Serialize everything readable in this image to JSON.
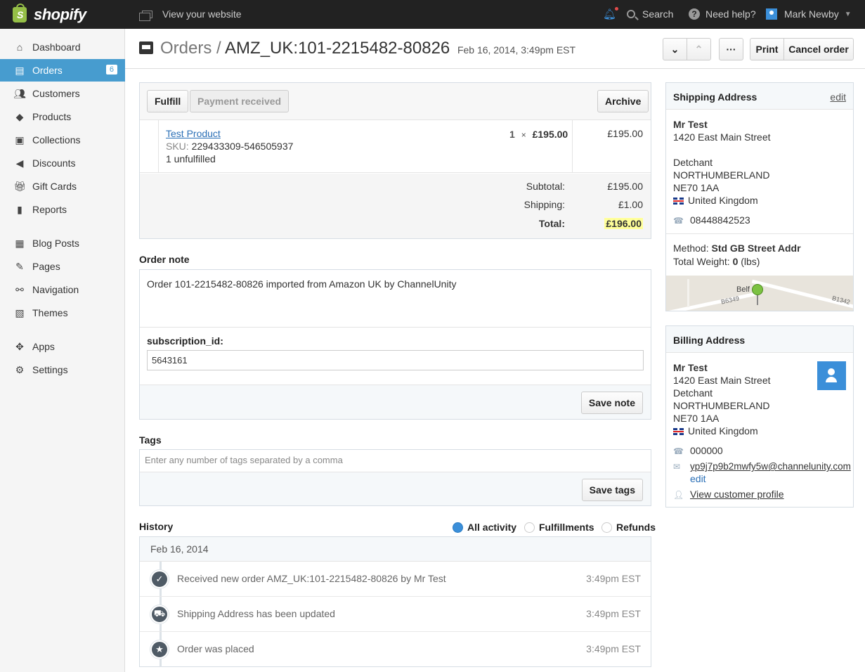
{
  "topbar": {
    "brand": "shopify",
    "view_website": "View your website",
    "search": "Search",
    "help": "Need help?",
    "user": "Mark Newby"
  },
  "sidebar": {
    "items": [
      {
        "label": "Dashboard",
        "icon": "home-icon"
      },
      {
        "label": "Orders",
        "icon": "orders-icon",
        "badge": "6",
        "active": true
      },
      {
        "label": "Customers",
        "icon": "customers-icon"
      },
      {
        "label": "Products",
        "icon": "tag-icon"
      },
      {
        "label": "Collections",
        "icon": "box-icon"
      },
      {
        "label": "Discounts",
        "icon": "megaphone-icon"
      },
      {
        "label": "Gift Cards",
        "icon": "gift-icon"
      },
      {
        "label": "Reports",
        "icon": "bar-chart-icon"
      },
      {
        "label": "Blog Posts",
        "icon": "newspaper-icon"
      },
      {
        "label": "Pages",
        "icon": "pages-icon"
      },
      {
        "label": "Navigation",
        "icon": "link-icon"
      },
      {
        "label": "Themes",
        "icon": "image-icon"
      },
      {
        "label": "Apps",
        "icon": "apps-icon"
      },
      {
        "label": "Settings",
        "icon": "gear-icon"
      }
    ]
  },
  "header": {
    "crumb": "Orders",
    "separator": "/",
    "order_id": "AMZ_UK:101-2215482-80826",
    "date": "Feb 16, 2014, 3:49pm EST",
    "print": "Print",
    "cancel": "Cancel order",
    "more": "···"
  },
  "order": {
    "fulfill": "Fulfill",
    "payment": "Payment received",
    "archive": "Archive",
    "product_name": "Test Product",
    "sku_label": "SKU:",
    "sku": "229433309-546505937",
    "unfulfilled": "1 unfulfilled",
    "qty": "1",
    "times": "×",
    "unit_price": "£195.00",
    "line_total": "£195.00",
    "subtotal_label": "Subtotal:",
    "subtotal": "£195.00",
    "shipping_label": "Shipping:",
    "shipping": "£1.00",
    "total_label": "Total:",
    "total": "£196.00"
  },
  "note": {
    "label": "Order note",
    "text": "Order 101-2215482-80826 imported from Amazon UK by ChannelUnity",
    "attr_label": "subscription_id:",
    "attr_value": "5643161",
    "save": "Save note"
  },
  "tags": {
    "label": "Tags",
    "placeholder": "Enter any number of tags separated by a comma",
    "save": "Save tags"
  },
  "history": {
    "label": "History",
    "filters": [
      "All activity",
      "Fulfillments",
      "Refunds"
    ],
    "date": "Feb 16, 2014",
    "events": [
      {
        "text": "Received new order AMZ_UK:101-2215482-80826 by Mr Test",
        "time": "3:49pm EST",
        "icon": "check-icon"
      },
      {
        "text": "Shipping Address has been updated",
        "time": "3:49pm EST",
        "icon": "truck-icon"
      },
      {
        "text": "Order was placed",
        "time": "3:49pm EST",
        "icon": "star-icon"
      }
    ]
  },
  "shipping": {
    "title": "Shipping Address",
    "edit": "edit",
    "name": "Mr Test",
    "street": "1420 East Main Street",
    "city": "Detchant",
    "county": "NORTHUMBERLAND",
    "postcode": "NE70 1AA",
    "country": "United Kingdom",
    "phone": "08448842523",
    "method_label": "Method:",
    "method": "Std GB Street Addr",
    "weight_label": "Total Weight:",
    "weight_value": "0",
    "weight_unit": "(lbs)",
    "map_labels": [
      "Belf",
      "B6349",
      "B1342"
    ]
  },
  "billing": {
    "title": "Billing Address",
    "name": "Mr Test",
    "street": "1420 East Main Street",
    "city": "Detchant",
    "county": "NORTHUMBERLAND",
    "postcode": "NE70 1AA",
    "country": "United Kingdom",
    "phone": "000000",
    "email": "yp9j7p9b2mwfy5w@channelunity.com",
    "edit": "edit",
    "profile": "View customer profile"
  }
}
